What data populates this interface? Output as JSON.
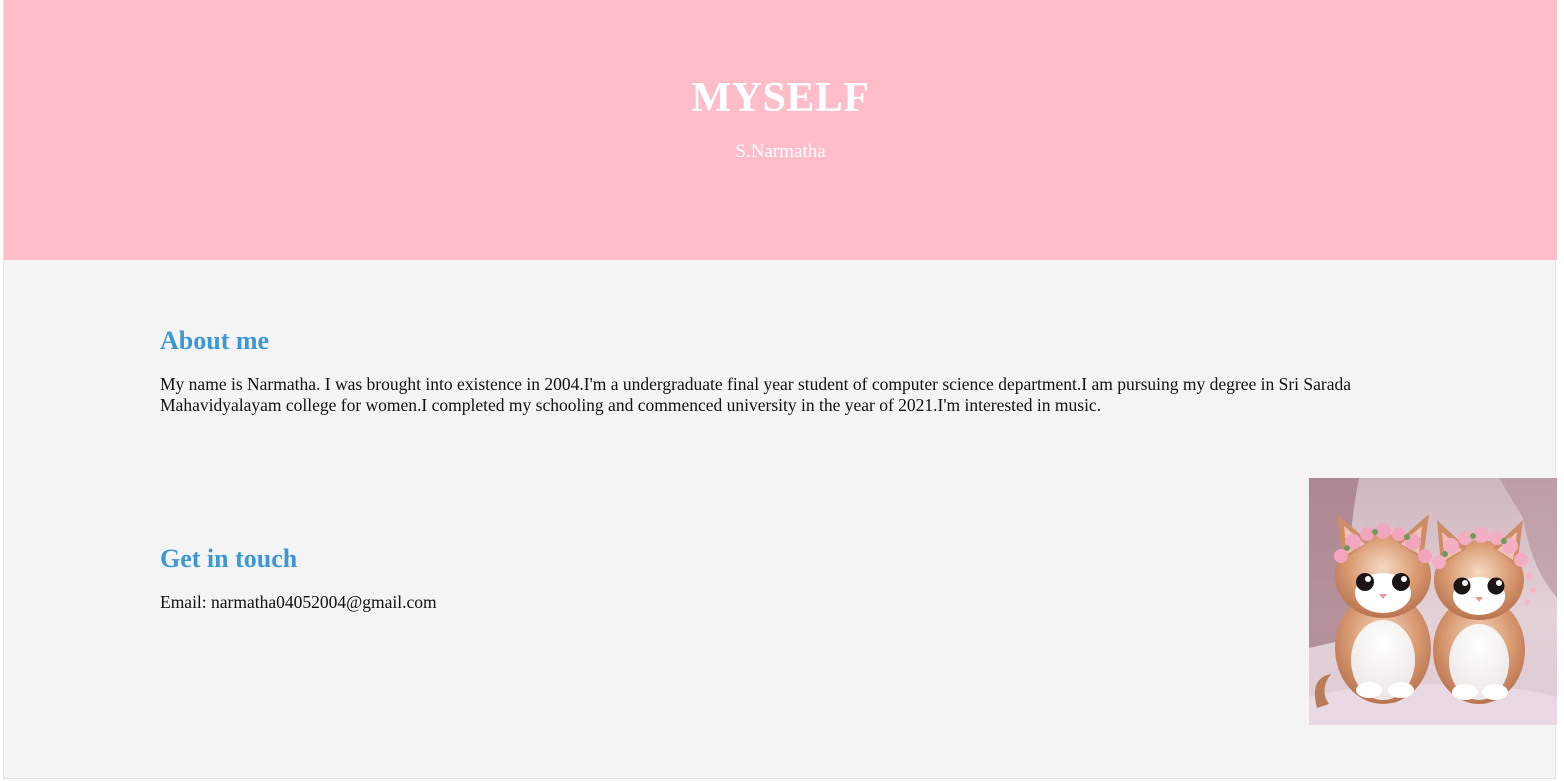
{
  "header": {
    "title": "MYSELF",
    "subtitle": "S.Narmatha",
    "background_color": "#ffbdca"
  },
  "about": {
    "heading": "About me",
    "text": "My name is Narmatha. I was brought into existence in 2004.I'm a undergraduate final year student of computer science department.I am pursuing my degree in Sri Sarada Mahavidyalayam college for women.I completed my schooling and commenced university in the year of 2021.I'm interested in music."
  },
  "contact": {
    "heading": "Get in touch",
    "email_line": "Email: narmatha04052004@gmail.com"
  },
  "image": {
    "subject": "two-kittens-with-flower-crowns"
  },
  "colors": {
    "accent": "#3d97d3",
    "page_background": "#f4f4f4"
  }
}
